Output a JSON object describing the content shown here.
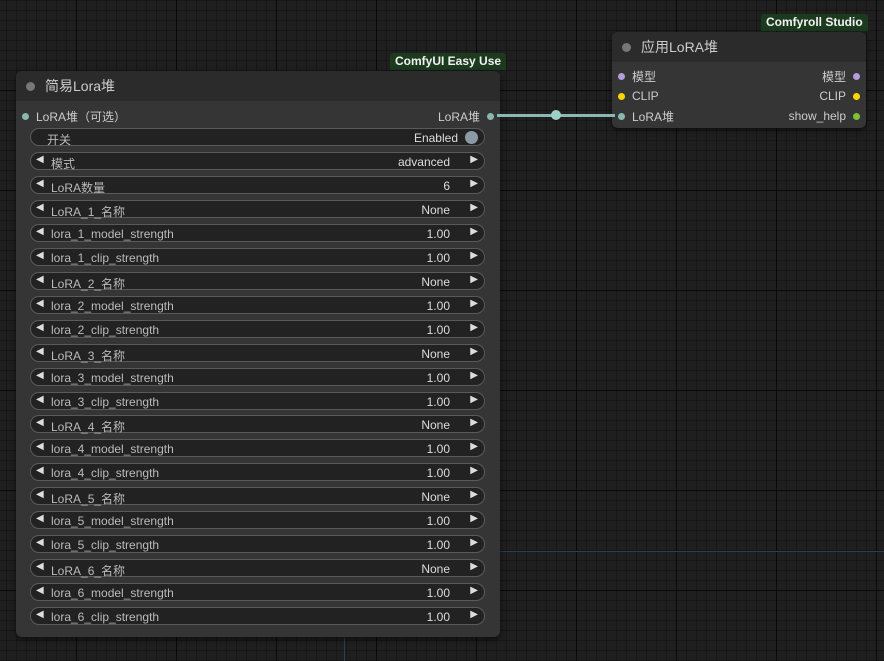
{
  "node_left": {
    "badge": "ComfyUI Easy Use",
    "title": "简易Lora堆",
    "input_label": "LoRA堆（可选）",
    "output_label": "LoRA堆",
    "toggle": {
      "label": "开关",
      "value": "Enabled"
    },
    "widgets": [
      {
        "label": "模式",
        "value": "advanced"
      },
      {
        "label": "LoRA数量",
        "value": "6"
      },
      {
        "label": "LoRA_1_名称",
        "value": "None"
      },
      {
        "label": "lora_1_model_strength",
        "value": "1.00"
      },
      {
        "label": "lora_1_clip_strength",
        "value": "1.00"
      },
      {
        "label": "LoRA_2_名称",
        "value": "None"
      },
      {
        "label": "lora_2_model_strength",
        "value": "1.00"
      },
      {
        "label": "lora_2_clip_strength",
        "value": "1.00"
      },
      {
        "label": "LoRA_3_名称",
        "value": "None"
      },
      {
        "label": "lora_3_model_strength",
        "value": "1.00"
      },
      {
        "label": "lora_3_clip_strength",
        "value": "1.00"
      },
      {
        "label": "LoRA_4_名称",
        "value": "None"
      },
      {
        "label": "lora_4_model_strength",
        "value": "1.00"
      },
      {
        "label": "lora_4_clip_strength",
        "value": "1.00"
      },
      {
        "label": "LoRA_5_名称",
        "value": "None"
      },
      {
        "label": "lora_5_model_strength",
        "value": "1.00"
      },
      {
        "label": "lora_5_clip_strength",
        "value": "1.00"
      },
      {
        "label": "LoRA_6_名称",
        "value": "None"
      },
      {
        "label": "lora_6_model_strength",
        "value": "1.00"
      },
      {
        "label": "lora_6_clip_strength",
        "value": "1.00"
      }
    ]
  },
  "node_right": {
    "badge": "Comfyroll Studio",
    "title": "应用LoRA堆",
    "inputs": [
      {
        "label": "模型",
        "color": "#b39ddb"
      },
      {
        "label": "CLIP",
        "color": "#ffd500"
      },
      {
        "label": "LoRA堆",
        "color": "#8ab8b0"
      }
    ],
    "outputs": [
      {
        "label": "模型",
        "color": "#b39ddb"
      },
      {
        "label": "CLIP",
        "color": "#ffd500"
      },
      {
        "label": "show_help",
        "color": "#7ec234"
      }
    ]
  },
  "colors": {
    "lora_stack_slot": "#8ab8b0",
    "badge_bg": "#1b3a1e"
  },
  "icons": {
    "left_arrow": "◀",
    "right_arrow": "▶"
  }
}
